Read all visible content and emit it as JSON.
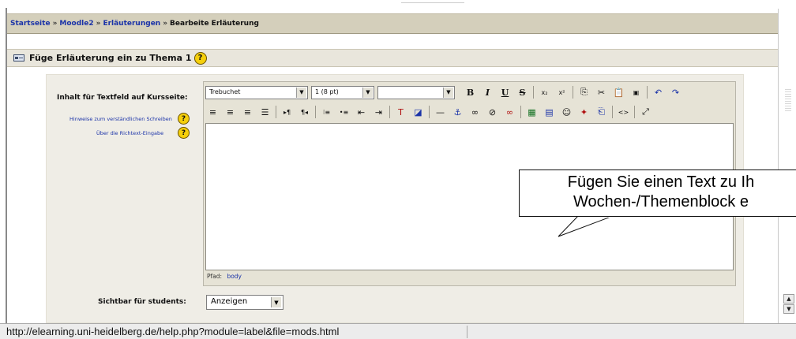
{
  "breadcrumb": {
    "items": [
      "Startseite",
      "Moodle2",
      "Erläuterungen"
    ],
    "separator": "»",
    "current": "Bearbeite Erläuterung"
  },
  "heading": {
    "title": "Füge Erläuterung ein zu Thema 1",
    "help_glyph": "?"
  },
  "form": {
    "content_label": "Inhalt für Textfeld auf Kursseite:",
    "help_link_writing": "Hinweise zum verständlichen Schreiben",
    "help_link_richtext": "Über die Richtext-Eingabe",
    "visible_label": "Sichtbar für students:",
    "visible_value": "Anzeigen"
  },
  "editor": {
    "font_family": "Trebuchet",
    "font_size": "1 (8 pt)",
    "format_value": "",
    "path_label": "Pfad:",
    "path_value": "body",
    "toolbar_row1": [
      {
        "name": "bold-button",
        "glyph": "B",
        "cls": "bold"
      },
      {
        "name": "italic-button",
        "glyph": "I",
        "cls": "ital"
      },
      {
        "name": "underline-button",
        "glyph": "U",
        "cls": "und"
      },
      {
        "name": "strikethrough-button",
        "glyph": "S",
        "cls": "strk"
      },
      {
        "sep": true
      },
      {
        "name": "subscript-button",
        "glyph": "x₂",
        "cls": "small"
      },
      {
        "name": "superscript-button",
        "glyph": "x²",
        "cls": "small"
      },
      {
        "sep": true
      },
      {
        "name": "copy-button",
        "glyph": "⎘",
        "cls": ""
      },
      {
        "name": "cut-button",
        "glyph": "✂",
        "cls": ""
      },
      {
        "name": "paste-button",
        "glyph": "📋",
        "cls": ""
      },
      {
        "name": "paste-word-button",
        "glyph": "▣",
        "cls": "small"
      },
      {
        "sep": true
      },
      {
        "name": "undo-button",
        "glyph": "↶",
        "cls": "blue"
      },
      {
        "name": "redo-button",
        "glyph": "↷",
        "cls": "blue"
      }
    ],
    "toolbar_row2": [
      {
        "name": "align-left-button",
        "glyph": "≡",
        "cls": ""
      },
      {
        "name": "align-center-button",
        "glyph": "≡",
        "cls": ""
      },
      {
        "name": "align-right-button",
        "glyph": "≡",
        "cls": ""
      },
      {
        "name": "justify-button",
        "glyph": "☰",
        "cls": ""
      },
      {
        "sep": true
      },
      {
        "name": "ltr-button",
        "glyph": "▸¶",
        "cls": "small"
      },
      {
        "name": "rtl-button",
        "glyph": "¶◂",
        "cls": "small"
      },
      {
        "sep": true
      },
      {
        "name": "ordered-list-button",
        "glyph": "⁝≡",
        "cls": "small"
      },
      {
        "name": "unordered-list-button",
        "glyph": "•≡",
        "cls": "small"
      },
      {
        "name": "outdent-button",
        "glyph": "⇤",
        "cls": ""
      },
      {
        "name": "indent-button",
        "glyph": "⇥",
        "cls": ""
      },
      {
        "sep": true
      },
      {
        "name": "text-color-button",
        "glyph": "T",
        "cls": "red"
      },
      {
        "name": "background-color-button",
        "glyph": "◪",
        "cls": "blue"
      },
      {
        "sep": true
      },
      {
        "name": "horizontal-rule-button",
        "glyph": "—",
        "cls": ""
      },
      {
        "name": "anchor-button",
        "glyph": "⚓",
        "cls": "blue"
      },
      {
        "name": "link-button",
        "glyph": "∞",
        "cls": ""
      },
      {
        "name": "nolink-button",
        "glyph": "⊘",
        "cls": ""
      },
      {
        "name": "unlink-button",
        "glyph": "∞",
        "cls": "red"
      },
      {
        "sep": true
      },
      {
        "name": "insert-image-button",
        "glyph": "▦",
        "cls": "green"
      },
      {
        "name": "insert-table-button",
        "glyph": "▤",
        "cls": "blue"
      },
      {
        "name": "smiley-button",
        "glyph": "☺",
        "cls": ""
      },
      {
        "name": "special-char-button",
        "glyph": "✦",
        "cls": "red"
      },
      {
        "name": "paste-special-button",
        "glyph": "⎗",
        "cls": "blue"
      },
      {
        "sep": true
      },
      {
        "name": "html-source-button",
        "glyph": "<>",
        "cls": "small"
      },
      {
        "sep": true
      },
      {
        "name": "fullscreen-button",
        "glyph": "⤢",
        "cls": ""
      }
    ]
  },
  "callout": {
    "line1": "Fügen Sie einen Text zu Ih",
    "line2": "Wochen-/Themenblock e"
  },
  "status_bar": {
    "url": "http://elearning.uni-heidelberg.de/help.php?module=label&file=mods.html"
  }
}
